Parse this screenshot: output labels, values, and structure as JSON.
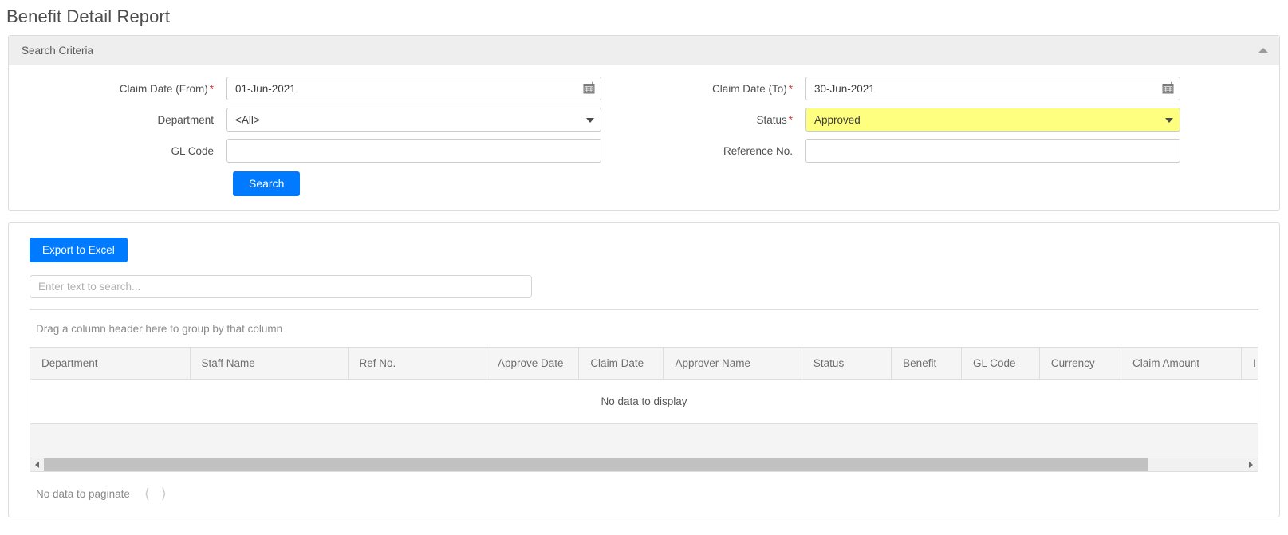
{
  "page": {
    "title": "Benefit Detail Report"
  },
  "search_panel": {
    "header": "Search Criteria",
    "collapse_icon": "caret-up-icon",
    "fields": {
      "claim_date_from": {
        "label": "Claim Date (From)",
        "required": "*",
        "value": "01-Jun-2021",
        "icon": "calendar-icon"
      },
      "claim_date_to": {
        "label": "Claim Date (To)",
        "required": "*",
        "value": "30-Jun-2021",
        "icon": "calendar-icon"
      },
      "department": {
        "label": "Department",
        "value": "<All>",
        "options": [
          "<All>"
        ]
      },
      "status": {
        "label": "Status",
        "required": "*",
        "value": "Approved",
        "options": [
          "Approved"
        ],
        "highlight_color": "#ffff7f"
      },
      "gl_code": {
        "label": "GL Code",
        "value": "",
        "placeholder": ""
      },
      "reference_no": {
        "label": "Reference No.",
        "value": "",
        "placeholder": ""
      }
    },
    "search_button": "Search"
  },
  "results_panel": {
    "export_button": "Export to Excel",
    "search_box_placeholder": "Enter text to search...",
    "search_box_value": "",
    "group_panel_text": "Drag a column header here to group by that column",
    "columns": [
      "Department",
      "Staff Name",
      "Ref No.",
      "Approve Date",
      "Claim Date",
      "Approver Name",
      "Status",
      "Benefit",
      "GL Code",
      "Currency",
      "Claim Amount",
      "I"
    ],
    "empty_message": "No data to display",
    "pagination": {
      "text": "No data to paginate",
      "prev_icon": "chevron-left-icon",
      "next_icon": "chevron-right-icon"
    },
    "scrollbar": {
      "left_icon": "scroll-left-arrow-icon",
      "right_icon": "scroll-right-arrow-icon"
    }
  },
  "theme": {
    "primary": "#007bff",
    "required_star": "#e03b3b",
    "highlight": "#ffff7f"
  }
}
